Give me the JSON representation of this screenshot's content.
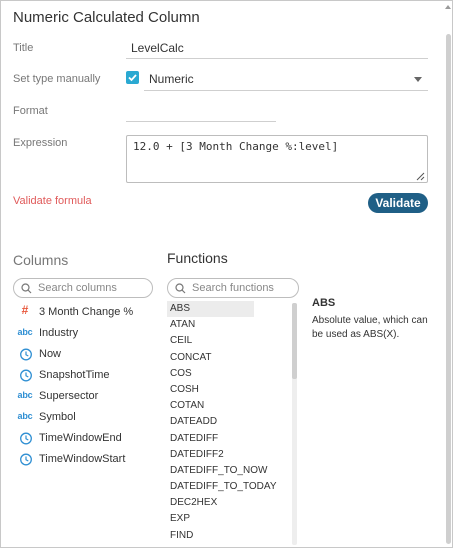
{
  "dialog": {
    "title": "Numeric Calculated Column"
  },
  "form": {
    "title_label": "Title",
    "title_value": "LevelCalc",
    "type_label": "Set type manually",
    "type_value": "Numeric",
    "format_label": "Format",
    "format_value": "",
    "expression_label": "Expression",
    "expression_value": "12.0 + [3 Month Change %:level]",
    "validate_link": "Validate formula",
    "validate_button": "Validate"
  },
  "columns": {
    "heading": "Columns",
    "search_placeholder": "Search columns",
    "items": [
      {
        "icon": "hash-icon",
        "glyph": "#",
        "label": "3 Month Change %"
      },
      {
        "icon": "text-type-icon",
        "glyph": "abc",
        "label": "Industry"
      },
      {
        "icon": "clock-icon",
        "glyph": "",
        "label": "Now"
      },
      {
        "icon": "clock-icon",
        "glyph": "",
        "label": "SnapshotTime"
      },
      {
        "icon": "text-type-icon",
        "glyph": "abc",
        "label": "Supersector"
      },
      {
        "icon": "text-type-icon",
        "glyph": "abc",
        "label": "Symbol"
      },
      {
        "icon": "clock-icon",
        "glyph": "",
        "label": "TimeWindowEnd"
      },
      {
        "icon": "clock-icon",
        "glyph": "",
        "label": "TimeWindowStart"
      }
    ]
  },
  "functions": {
    "heading": "Functions",
    "search_placeholder": "Search functions",
    "items": [
      "ABS",
      "ATAN",
      "CEIL",
      "CONCAT",
      "COS",
      "COSH",
      "COTAN",
      "DATEADD",
      "DATEDIFF",
      "DATEDIFF2",
      "DATEDIFF_TO_NOW",
      "DATEDIFF_TO_TODAY",
      "DEC2HEX",
      "EXP",
      "FIND"
    ],
    "selected": "ABS",
    "description_title": "ABS",
    "description_text": "Absolute value, which can be used as ABS(X)."
  },
  "colors": {
    "accent": "#2aa9d2",
    "button": "#1f5f86",
    "error_link": "#e05a5a",
    "hash_icon": "#e8573b",
    "type_icon": "#2f8fd3"
  }
}
